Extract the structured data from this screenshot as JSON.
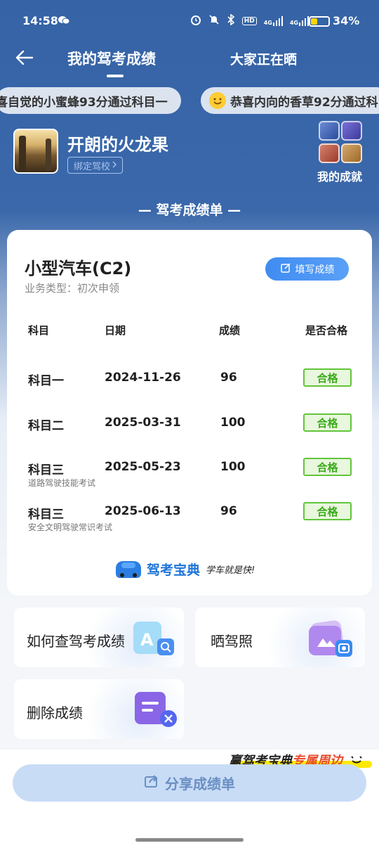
{
  "status": {
    "time": "14:58",
    "battery_pct": "34%",
    "hd": "HD",
    "signal1": "4G",
    "signal2": "4G"
  },
  "nav": {
    "active_tab": "我的驾考成绩",
    "other_tab": "大家正在晒"
  },
  "marquee": [
    "喜自觉的小蜜蜂93分通过科目一",
    "恭喜内向的香草92分通过科"
  ],
  "profile": {
    "name": "开朗的火龙果",
    "bind_school": "绑定驾校",
    "achievements_label": "我的成就"
  },
  "section_title": "— 驾考成绩单 —",
  "card": {
    "vehicle": "小型汽车(C2)",
    "business": "业务类型：初次申领",
    "fill_button": "填写成绩",
    "headers": [
      "科目",
      "日期",
      "成绩",
      "是否合格"
    ],
    "rows": [
      {
        "subject": "科目一",
        "note": "",
        "date": "2024-11-26",
        "score": "96",
        "result": "合格"
      },
      {
        "subject": "科目二",
        "note": "",
        "date": "2025-03-31",
        "score": "100",
        "result": "合格"
      },
      {
        "subject": "科目三",
        "note": "道路驾驶技能考试",
        "date": "2025-05-23",
        "score": "100",
        "result": "合格"
      },
      {
        "subject": "科目三",
        "note": "安全文明驾驶常识考试",
        "date": "2025-06-13",
        "score": "96",
        "result": "合格"
      }
    ],
    "brand_name": "驾考宝典",
    "brand_slogan": "学车就是快!"
  },
  "tiles": {
    "how_to": "如何查驾考成绩",
    "show_license": "晒驾照",
    "delete": "删除成绩"
  },
  "promo": {
    "prefix": "赢驾考宝典",
    "highlight": "专属周边"
  },
  "share_button": "分享成绩单",
  "colors": {
    "header_blue": "#3563a6",
    "accent_blue": "#3f8cf2",
    "pass_green": "#3aaa19"
  }
}
